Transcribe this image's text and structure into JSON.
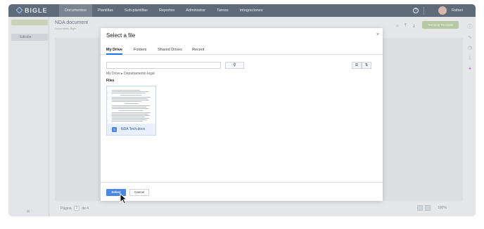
{
  "app": {
    "logo_text": "BIGLE",
    "nav": [
      {
        "label": "Documentos",
        "active": true
      },
      {
        "label": "Plantillas"
      },
      {
        "label": "Sub-plantillas"
      },
      {
        "label": "Reportes"
      },
      {
        "label": "Administrar"
      },
      {
        "label": "Tareas"
      },
      {
        "label": "Integraciones"
      }
    ],
    "user_name": "Rafael",
    "help_glyph": "?"
  },
  "sidebar": {
    "item_label": "Edición"
  },
  "document": {
    "title": "NDA document",
    "subtitle": "Documento Bigle",
    "primary_action": "Terminar Revisión"
  },
  "pager": {
    "label": "Página",
    "current": "1",
    "of": "de 4",
    "zoom": "100%"
  },
  "dialog": {
    "title": "Select a file",
    "close_glyph": "×",
    "tabs": [
      "My Drive",
      "Folders",
      "Shared Drives",
      "Recent"
    ],
    "active_tab": "My Drive",
    "search_placeholder": "",
    "search_glyph": "⚲",
    "breadcrumb": [
      "My Drive",
      "Departamento legal"
    ],
    "breadcrumb_sep": "▸",
    "files_heading": "Files",
    "file": {
      "name": "NDA Tech.docx",
      "icon": "doc-icon"
    },
    "select_label": "Select",
    "cancel_label": "Cancel"
  },
  "colors": {
    "topbar": "#5f6b78",
    "accent_blue": "#4a86e8",
    "primary_pill": "#b7c9a3"
  }
}
